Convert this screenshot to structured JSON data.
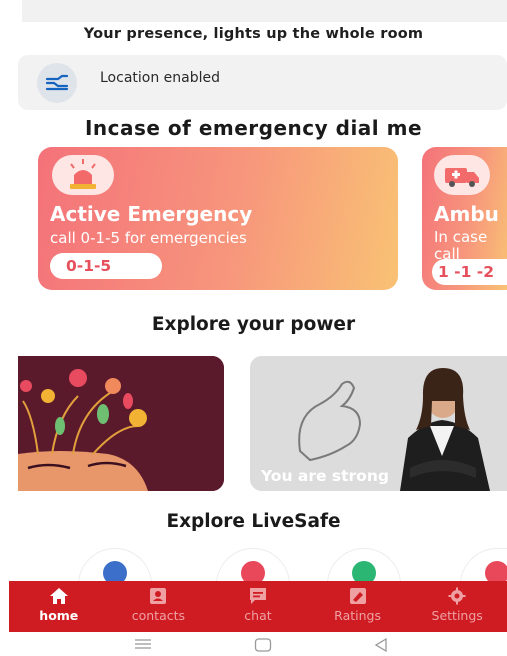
{
  "header": {
    "subtitle": "Your presence, lights up the whole room"
  },
  "location": {
    "status": "Location enabled",
    "icon": "route-icon"
  },
  "emergency": {
    "heading": "Incase of emergency dial me",
    "cards": [
      {
        "title": "Active Emergency",
        "subtitle": "call 0-1-5 for emergencies",
        "number": "0-1-5",
        "icon": "siren-icon"
      },
      {
        "title": "Ambu",
        "subtitle": "In case call",
        "number": "1 -1 -2",
        "icon": "ambulance-icon"
      }
    ]
  },
  "power": {
    "heading": "Explore your power",
    "cards": [
      {
        "caption": "",
        "image": "mind-flowers-illustration"
      },
      {
        "caption": "You are strong",
        "image": "strong-woman-photo"
      }
    ]
  },
  "livesafe": {
    "heading": "Explore LiveSafe",
    "items": [
      {
        "icon": "police-icon",
        "color": "#3b6fc9"
      },
      {
        "icon": "hospital-icon",
        "color": "#e8485a"
      },
      {
        "icon": "pharmacy-icon",
        "color": "#2bb673"
      },
      {
        "icon": "bus-icon",
        "color": "#e8485a"
      }
    ]
  },
  "tabs": [
    {
      "label": "home",
      "icon": "home-icon",
      "active": true
    },
    {
      "label": "contacts",
      "icon": "contacts-icon",
      "active": false
    },
    {
      "label": "chat",
      "icon": "chat-icon",
      "active": false
    },
    {
      "label": "Ratings",
      "icon": "ratings-icon",
      "active": false
    },
    {
      "label": "Settings",
      "icon": "settings-icon",
      "active": false
    }
  ],
  "colors": {
    "accent": "#cf1c23",
    "card_gradient_start": "#f4727a",
    "card_gradient_end": "#f9c274"
  }
}
